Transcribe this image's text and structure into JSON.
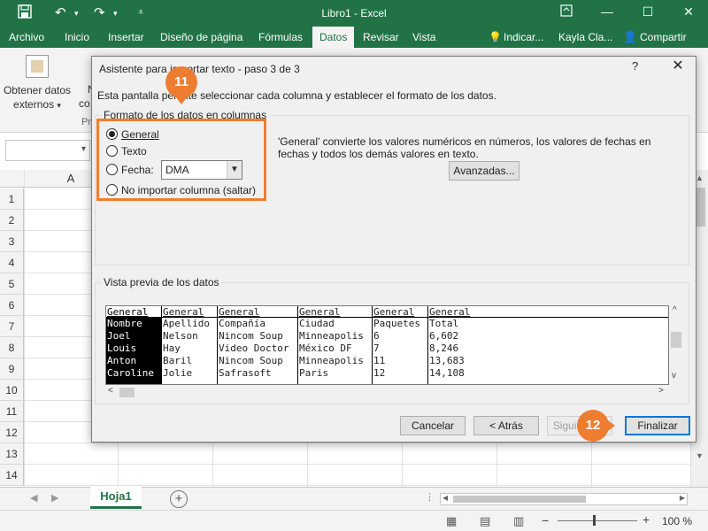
{
  "titlebar": {
    "title": "Libro1 - Excel"
  },
  "ribbon_tabs": [
    "Archivo",
    "Inicio",
    "Insertar",
    "Diseño de página",
    "Fórmulas",
    "Datos",
    "Revisar",
    "Vista"
  ],
  "tell_me": "Indicar...",
  "user": "Kayla Cla...",
  "share": "Compartir",
  "ribbon": {
    "get_data_line1": "Obtener datos",
    "get_data_line2": "externos",
    "cut_text1": "N",
    "cut_text2": "co",
    "cut_text3": "Pr"
  },
  "grid": {
    "col_a": "A",
    "rows": [
      "1",
      "2",
      "3",
      "4",
      "5",
      "6",
      "7",
      "8",
      "9",
      "10",
      "11",
      "12",
      "13",
      "14"
    ]
  },
  "sheet": {
    "tab": "Hoja1",
    "add": "+"
  },
  "status": {
    "zoom_minus": "−",
    "zoom_plus": "+",
    "zoom": "100 %"
  },
  "dialog": {
    "title": "Asistente para importar texto - paso 3 de 3",
    "help": "?",
    "intro": "Esta pantalla permite seleccionar cada columna y establecer el formato de los datos.",
    "format_legend": "Formato de los datos en columnas",
    "options": {
      "general": "General",
      "text": "Texto",
      "date": "Fecha:",
      "skip": "No importar columna (saltar)"
    },
    "selected_option": "general",
    "date_format": "DMA",
    "description": "'General' convierte los valores numéricos en números, los valores de fechas en fechas y todos los demás valores en texto.",
    "advanced_button": "Avanzadas...",
    "preview_legend": "Vista previa de los datos",
    "preview": {
      "headers": [
        "General",
        "General",
        "General",
        "General",
        "General",
        "General"
      ],
      "columns": [
        [
          "Nombre",
          "Joel",
          "Louis",
          "Anton",
          "Caroline"
        ],
        [
          "Apellido",
          "Nelson",
          "Hay",
          "Baril",
          "Jolie"
        ],
        [
          "Compañía",
          "Nincom Soup",
          "Video Doctor",
          "Nincom Soup",
          "Safrasoft"
        ],
        [
          "Ciudad",
          "Minneapolis",
          "México DF",
          "Minneapolis",
          "Paris"
        ],
        [
          "Paquetes",
          "6",
          "7",
          "11",
          "12"
        ],
        [
          "Total",
          "6,602",
          "8,246",
          "13,683",
          "14,108"
        ]
      ]
    },
    "buttons": {
      "cancel": "Cancelar",
      "back": "< Atrás",
      "next": "Siguiente >",
      "finish": "Finalizar"
    }
  },
  "callouts": {
    "step1": "11",
    "step2": "12",
    "color": "#ed7d31"
  },
  "colors": {
    "excel_green": "#217346",
    "accent_blue": "#0078d7"
  }
}
